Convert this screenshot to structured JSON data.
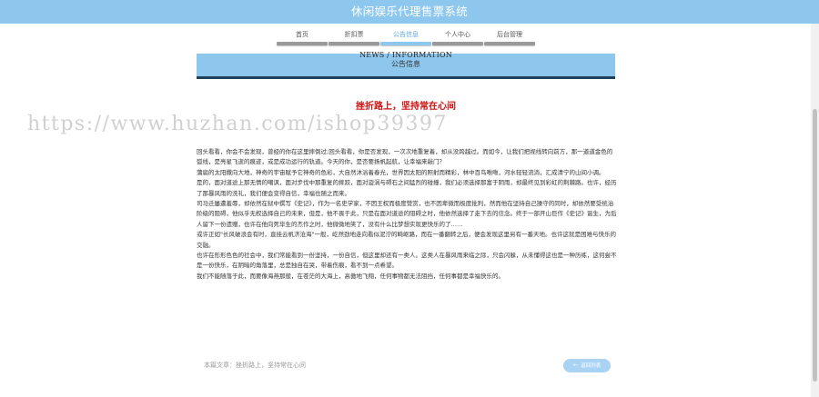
{
  "header": {
    "title": "休闲娱乐代理售票系统"
  },
  "nav": {
    "items": [
      {
        "label": "首页"
      },
      {
        "label": "折扣票"
      },
      {
        "label": "公告信息"
      },
      {
        "label": "个人中心"
      },
      {
        "label": "后台管理"
      }
    ],
    "active": "公告信息"
  },
  "banner": {
    "title_en": "NEWS / INFORMATION",
    "title_cn": "公告信息"
  },
  "article": {
    "title": "挫折路上，坚持常在心间",
    "paragraphs": [
      "回头看看，你会不会发现，曾经的你在这里摔倒过;回头看看，你是否发现，一次次地重复着，却从没跨越过。而如今，让我们把视线转向前方，那一道道金色的弧线，是亮星飞逝的痕迹，或是成功运行的轨道。今天的你，是否要扬帆起航，让幸福来敲门？",
      "蒲扁的太阳撒向大地，神奇的宇宙赋予它神奇的色彩，大自然沐浴着春光，世界因太阳的照射而精彩，林中百鸟啾啾，河水轻轻流淌，汇成清宁的山间小调。",
      "是的，面对道途上那无情的嘲讽，面对步伐中那重复的摔跤，面对漩涡与碍石之间猛烈的碰撞，我们必须选择那富于阴雨，却最终见到彩虹的荆棘路。也许，经历了那暴风雨的洗礼，我们便会变得自信，幸福也随之而来。",
      "司马迁屡遭羞辱，却依然在狱中撰写《史记》，作为一名史学家，不因王权而极度赞赏，也不因卑微而极度批判，然而他在坚持自己操守的同时，却依然要受统治阶级的阻碍，他似乎无权选择自己的未来，但是，他不畏于此，只是在面对道途的阻碍之时，他依然选择了走下去的信念。终于一部开山巨作《史记》诞生，为后人留下一份遗赠，也许在他向死毕生的杰作之时，他微微地笑了，没有什么比梦想实现更快乐的了……",
      "或许正如\"长风破浪会有时，直挂云帆济沧海\"一般，屹然劲地走向看似泥泞的畸岖路，而在一番翻转之后，便会发现这里另有一番天地。也许这就是困难与快乐的交融。",
      "也许在形形色色的社会中，我们常能看到一份坚持，一份自信，但这里却还有一类人。这类人在暴风雨来临之际，只会闪躲，从未懂得这也是一种历练，这何尝不是一份快乐，在阴暗的角落里，总是独自在哭，带着伤痕，看不到一点希望。",
      "我们不能随落于此，而要像海燕那般，在苍茫的大海上，高傲地飞翔，任何事物都无法阻挡，任何事都是幸福快乐的。"
    ]
  },
  "footer": {
    "label": "本篇文章：挫折路上，坚持常在心间",
    "back_button": "返回列表"
  },
  "watermark": "https://www.huzhan.com/ishop39397",
  "colors": {
    "primary": "#8ec7ee",
    "title_red": "#cc1111",
    "banner_underline": "#1f3f5c"
  }
}
